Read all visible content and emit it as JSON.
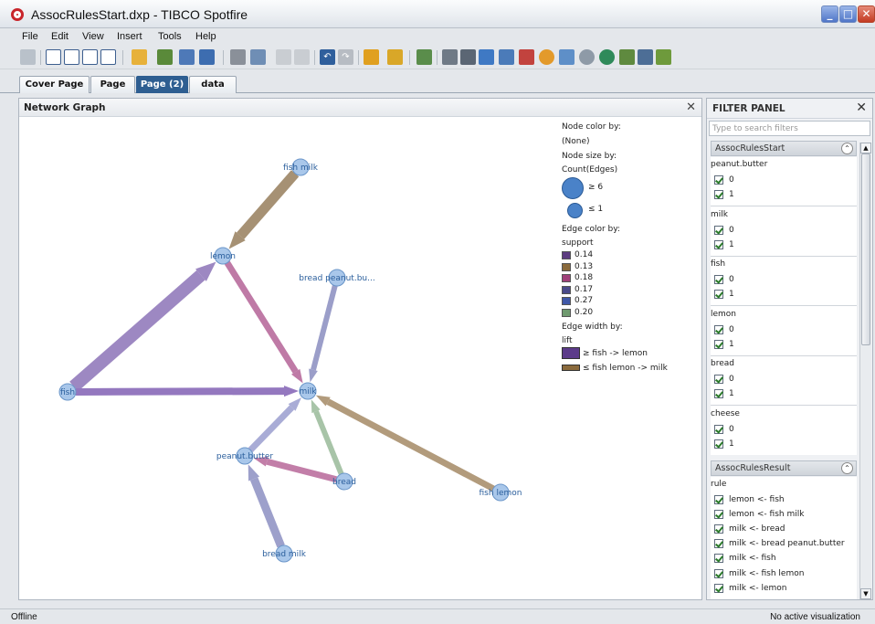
{
  "window": {
    "title": "AssocRulesStart.dxp - TIBCO Spotfire",
    "min_icon": "minimize-icon",
    "max_icon": "maximize-icon",
    "close_icon": "close-icon"
  },
  "menu": [
    "File",
    "Edit",
    "View",
    "Insert",
    "Tools",
    "Help"
  ],
  "tabs": [
    {
      "label": "Cover Page",
      "active": false
    },
    {
      "label": "Page",
      "active": false
    },
    {
      "label": "Page (2)",
      "active": true
    },
    {
      "label": "data",
      "active": false
    }
  ],
  "visualization": {
    "title": "Network Graph",
    "nodes": [
      {
        "id": "fish_milk",
        "label": "fish milk"
      },
      {
        "id": "lemon",
        "label": "lemon"
      },
      {
        "id": "bread_pb",
        "label": "bread peanut.bu..."
      },
      {
        "id": "fish",
        "label": "fish"
      },
      {
        "id": "milk",
        "label": "milk"
      },
      {
        "id": "peanut_butter",
        "label": "peanut.butter"
      },
      {
        "id": "bread",
        "label": "bread"
      },
      {
        "id": "fish_lemon",
        "label": "fish lemon"
      },
      {
        "id": "bread_milk",
        "label": "bread milk"
      }
    ],
    "edges": [
      {
        "from": "fish_milk",
        "to": "lemon",
        "color": "#a69174"
      },
      {
        "from": "fish",
        "to": "lemon",
        "color": "#9d88c2"
      },
      {
        "from": "lemon",
        "to": "milk",
        "color": "#bf7aa6"
      },
      {
        "from": "bread_pb",
        "to": "milk",
        "color": "#9b9ec9"
      },
      {
        "from": "fish",
        "to": "milk",
        "color": "#9478bf"
      },
      {
        "from": "peanut_butter",
        "to": "milk",
        "color": "#a9acd6"
      },
      {
        "from": "bread",
        "to": "milk",
        "color": "#a8c4a8"
      },
      {
        "from": "fish_lemon",
        "to": "milk",
        "color": "#b29b7c"
      },
      {
        "from": "bread",
        "to": "peanut_butter",
        "color": "#c27ea8"
      },
      {
        "from": "bread_milk",
        "to": "peanut_butter",
        "color": "#9da0cb"
      }
    ],
    "legend": {
      "node_color_title": "Node color by:",
      "node_color_value": "(None)",
      "node_size_title": "Node size by:",
      "node_size_value": "Count(Edges)",
      "size_large": "≥ 6",
      "size_small": "≤ 1",
      "edge_color_title": "Edge color by:",
      "edge_color_value": "support",
      "edge_colors": [
        {
          "label": "0.14",
          "color": "#5c3b80"
        },
        {
          "label": "0.13",
          "color": "#8a6a3c"
        },
        {
          "label": "0.18",
          "color": "#a0407a"
        },
        {
          "label": "0.17",
          "color": "#4a4a8a"
        },
        {
          "label": "0.27",
          "color": "#3f58a8"
        },
        {
          "label": "0.20",
          "color": "#6f9a6f"
        }
      ],
      "edge_width_title": "Edge width by:",
      "edge_width_value": "lift",
      "width_large": "≥ fish -> lemon",
      "width_large_color": "#5c3b8a",
      "width_small": "≤ fish lemon -> milk",
      "width_small_color": "#8a6a3c"
    }
  },
  "filter_panel": {
    "title": "FILTER PANEL",
    "search_placeholder": "Type to search filters",
    "table1": "AssocRulesStart",
    "filters": [
      {
        "name": "peanut.butter",
        "values": [
          "0",
          "1"
        ]
      },
      {
        "name": "milk",
        "values": [
          "0",
          "1"
        ]
      },
      {
        "name": "fish",
        "values": [
          "0",
          "1"
        ]
      },
      {
        "name": "lemon",
        "values": [
          "0",
          "1"
        ]
      },
      {
        "name": "bread",
        "values": [
          "0",
          "1"
        ]
      },
      {
        "name": "cheese",
        "values": [
          "0",
          "1"
        ]
      }
    ],
    "table2": "AssocRulesResult",
    "rule_name": "rule",
    "rules": [
      "lemon <- fish",
      "lemon <- fish milk",
      "milk <- bread",
      "milk <- bread peanut.butter",
      "milk <- fish",
      "milk <- fish lemon",
      "milk <- lemon"
    ]
  },
  "status": {
    "left": "Offline",
    "right": "No active visualization"
  }
}
